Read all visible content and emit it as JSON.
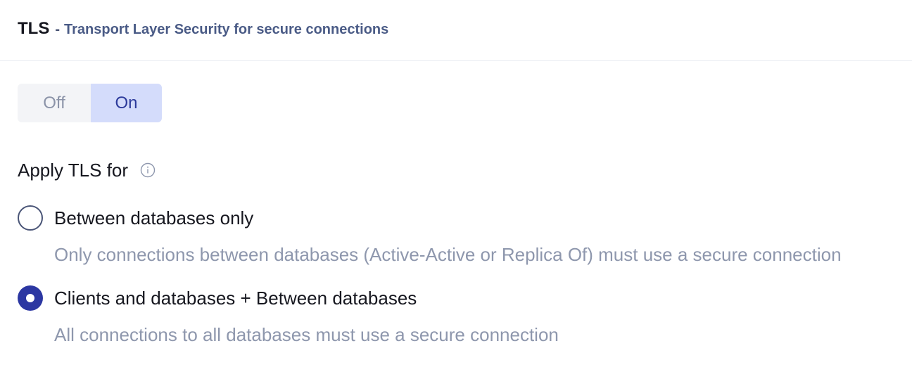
{
  "header": {
    "title": "TLS",
    "separator": "-",
    "description": "Transport Layer Security for secure connections"
  },
  "toggle": {
    "off_label": "Off",
    "on_label": "On",
    "selected": "On"
  },
  "apply": {
    "label": "Apply TLS for",
    "info_icon": "info-circle-icon"
  },
  "options": [
    {
      "label": "Between databases only",
      "description": "Only connections between databases (Active-Active or Replica Of) must use a secure connection",
      "checked": false
    },
    {
      "label": "Clients and databases + Between databases",
      "description": "All connections to all databases must use a secure connection",
      "checked": true
    }
  ],
  "colors": {
    "accent": "#2c37a2",
    "toggle_active_bg": "#d4dcfb",
    "toggle_inactive_bg": "#f3f4f7",
    "muted_text": "#8e97ad"
  }
}
